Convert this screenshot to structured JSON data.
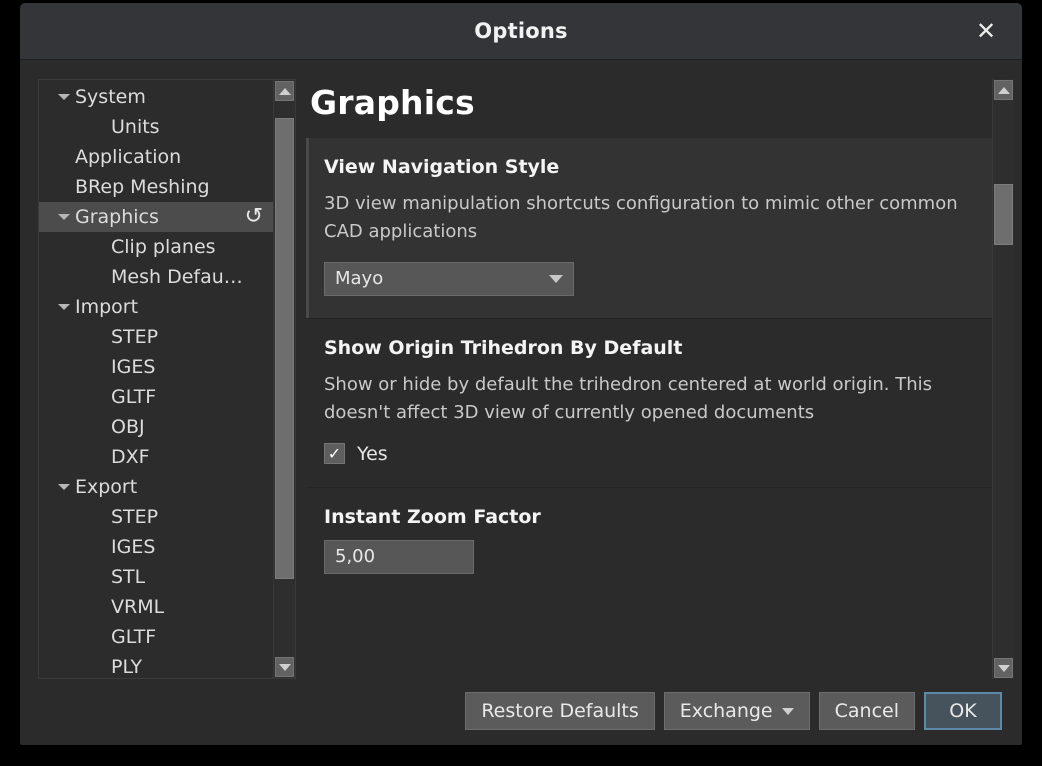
{
  "window": {
    "title": "Options",
    "close_icon": "close-icon",
    "close_glyph": "✕"
  },
  "sidebar": {
    "items": [
      {
        "label": "System",
        "level": "root",
        "expandable": true,
        "selected": false
      },
      {
        "label": "Units",
        "level": "child",
        "expandable": false,
        "selected": false
      },
      {
        "label": "Application",
        "level": "root",
        "expandable": false,
        "selected": false
      },
      {
        "label": "BRep Meshing",
        "level": "root",
        "expandable": false,
        "selected": false
      },
      {
        "label": "Graphics",
        "level": "root",
        "expandable": true,
        "selected": true,
        "reset_glyph": "↺"
      },
      {
        "label": "Clip planes",
        "level": "child",
        "expandable": false,
        "selected": false
      },
      {
        "label": "Mesh Defau…",
        "level": "child",
        "expandable": false,
        "selected": false
      },
      {
        "label": "Import",
        "level": "root",
        "expandable": true,
        "selected": false
      },
      {
        "label": "STEP",
        "level": "child",
        "expandable": false,
        "selected": false
      },
      {
        "label": "IGES",
        "level": "child",
        "expandable": false,
        "selected": false
      },
      {
        "label": "GLTF",
        "level": "child",
        "expandable": false,
        "selected": false
      },
      {
        "label": "OBJ",
        "level": "child",
        "expandable": false,
        "selected": false
      },
      {
        "label": "DXF",
        "level": "child",
        "expandable": false,
        "selected": false
      },
      {
        "label": "Export",
        "level": "root",
        "expandable": true,
        "selected": false
      },
      {
        "label": "STEP",
        "level": "child",
        "expandable": false,
        "selected": false
      },
      {
        "label": "IGES",
        "level": "child",
        "expandable": false,
        "selected": false
      },
      {
        "label": "STL",
        "level": "child",
        "expandable": false,
        "selected": false
      },
      {
        "label": "VRML",
        "level": "child",
        "expandable": false,
        "selected": false
      },
      {
        "label": "GLTF",
        "level": "child",
        "expandable": false,
        "selected": false
      },
      {
        "label": "PLY",
        "level": "child",
        "expandable": false,
        "selected": false
      }
    ],
    "scrollbar": {
      "thumb_top_pct": 3,
      "thumb_height_pct": 83
    }
  },
  "content": {
    "page_title": "Graphics",
    "sections": [
      {
        "title": "View Navigation Style",
        "description": "3D view manipulation shortcuts configuration to mimic other common CAD applications",
        "control": "combobox",
        "value": "Mayo",
        "highlight": true
      },
      {
        "title": "Show Origin Trihedron By Default",
        "description": "Show or hide by default the trihedron centered at world origin. This doesn't affect 3D view of currently opened documents",
        "control": "checkbox",
        "value": "Yes",
        "checked": true,
        "check_glyph": "✓",
        "highlight": false
      },
      {
        "title": "Instant Zoom Factor",
        "description": "",
        "control": "textfield",
        "value": "5,00",
        "highlight": false
      }
    ],
    "scrollbar": {
      "thumb_top_pct": 15,
      "thumb_height_pct": 11
    }
  },
  "footer": {
    "buttons": [
      {
        "label": "Restore Defaults",
        "kind": "normal",
        "has_arrow": false
      },
      {
        "label": "Exchange",
        "kind": "normal",
        "has_arrow": true
      },
      {
        "label": "Cancel",
        "kind": "normal",
        "has_arrow": false
      },
      {
        "label": "OK",
        "kind": "default",
        "has_arrow": false
      }
    ]
  },
  "colors": {
    "window_bg": "#2b2b2b",
    "titlebar_bg": "#333538",
    "selection_bg": "#4c4c4c",
    "section_highlight_bg": "#333333",
    "control_bg": "#575757",
    "button_bg": "#5b5b5b",
    "default_button_bg": "#46525c",
    "default_button_border": "#5d8aa8",
    "text_primary": "#e9e9e9",
    "text_secondary": "#c9c9c9"
  }
}
